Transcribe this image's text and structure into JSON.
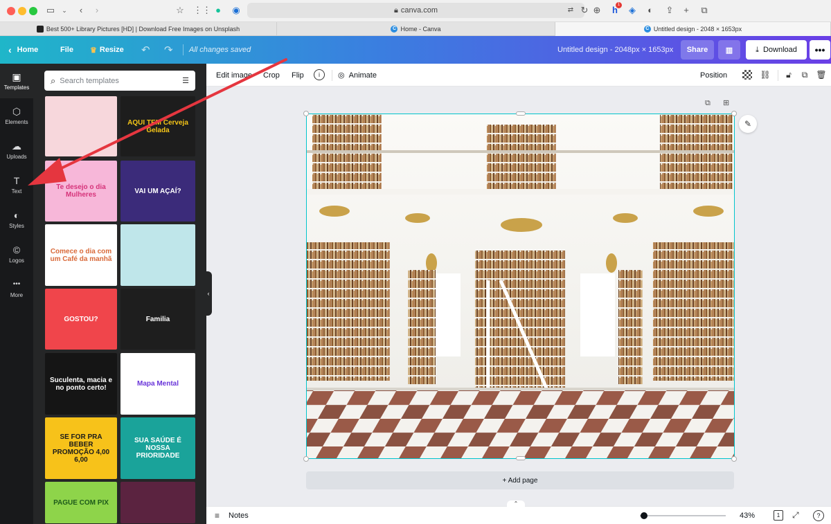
{
  "browser": {
    "url": "canva.com",
    "tabs": [
      {
        "label": "Best 500+ Library Pictures [HD] | Download Free Images on Unsplash",
        "icon": "unsplash-icon"
      },
      {
        "label": "Home - Canva",
        "icon": "canva-icon"
      },
      {
        "label": "Untitled design - 2048 × 1653px",
        "icon": "canva-icon"
      }
    ],
    "notification_badge": "1"
  },
  "header": {
    "home": "Home",
    "file": "File",
    "resize": "Resize",
    "status": "All changes saved",
    "design_title": "Untitled design - 2048px × 1653px",
    "share": "Share",
    "download": "Download",
    "more": "•••"
  },
  "rail": [
    {
      "label": "Templates",
      "icon": "templates-icon",
      "glyph": "▣"
    },
    {
      "label": "Elements",
      "icon": "elements-icon",
      "glyph": "⬡"
    },
    {
      "label": "Uploads",
      "icon": "uploads-icon",
      "glyph": "☁"
    },
    {
      "label": "Text",
      "icon": "text-icon",
      "glyph": "T"
    },
    {
      "label": "Styles",
      "icon": "styles-icon",
      "glyph": "◐"
    },
    {
      "label": "Logos",
      "icon": "logos-icon",
      "glyph": "©"
    },
    {
      "label": "More",
      "icon": "more-icon",
      "glyph": "•••"
    }
  ],
  "panel": {
    "search_placeholder": "Search templates",
    "templates": [
      {
        "text": "",
        "bg": "#f7d7dc",
        "fg": "#c2183d"
      },
      {
        "text": "AQUI TEM Cerveja Gelada",
        "bg": "#1d1d1d",
        "fg": "#f5c518"
      },
      {
        "text": "Te desejo o dia Mulheres",
        "bg": "#f7b7d9",
        "fg": "#d6337a"
      },
      {
        "text": "VAI UM AÇAÍ?",
        "bg": "#3b2b7a",
        "fg": "#ffffff"
      },
      {
        "text": "Comece o dia com um Café da manhã",
        "bg": "#ffffff",
        "fg": "#d96a3a"
      },
      {
        "text": "",
        "bg": "#bfe6ea",
        "fg": "#e24a4a"
      },
      {
        "text": "GOSTOU?",
        "bg": "#f0454b",
        "fg": "#ffffff"
      },
      {
        "text": "Familia",
        "bg": "#1e1e1e",
        "fg": "#ffffff"
      },
      {
        "text": "Suculenta, macia e no ponto certo!",
        "bg": "#151515",
        "fg": "#ffffff"
      },
      {
        "text": "Mapa Mental",
        "bg": "#ffffff",
        "fg": "#6a36d9"
      },
      {
        "text": "SE FOR PRA BEBER PROMOÇÃO 4,00 6,00",
        "bg": "#f7c21a",
        "fg": "#1b1b1b"
      },
      {
        "text": "SUA SAÚDE É NOSSA PRIORIDADE",
        "bg": "#1aa39a",
        "fg": "#ffffff"
      },
      {
        "text": "PAGUE COM PIX",
        "bg": "#8ed44a",
        "fg": "#1d5a1a"
      },
      {
        "text": "",
        "bg": "#5b2340",
        "fg": "#ffffff"
      }
    ]
  },
  "toolbar": {
    "edit_image": "Edit image",
    "crop": "Crop",
    "flip": "Flip",
    "animate": "Animate",
    "position": "Position"
  },
  "canvas": {
    "add_page": "+ Add page"
  },
  "footer": {
    "notes": "Notes",
    "zoom": "43%",
    "page_count": "1",
    "zoom_level_fraction": 0.05
  },
  "annotation": {
    "arrow_color": "#e5363f"
  }
}
